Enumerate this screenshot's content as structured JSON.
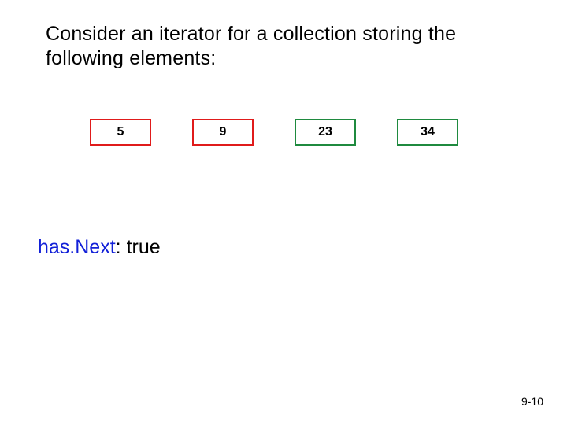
{
  "heading": "Consider an iterator for a collection storing the following elements:",
  "elements": [
    {
      "value": "5",
      "highlight": "red"
    },
    {
      "value": "9",
      "highlight": "red"
    },
    {
      "value": "23",
      "highlight": "green"
    },
    {
      "value": "34",
      "highlight": "green"
    }
  ],
  "status": {
    "method": "has.Next",
    "separator": ": ",
    "value": "true"
  },
  "footer": {
    "page": "9-10"
  }
}
